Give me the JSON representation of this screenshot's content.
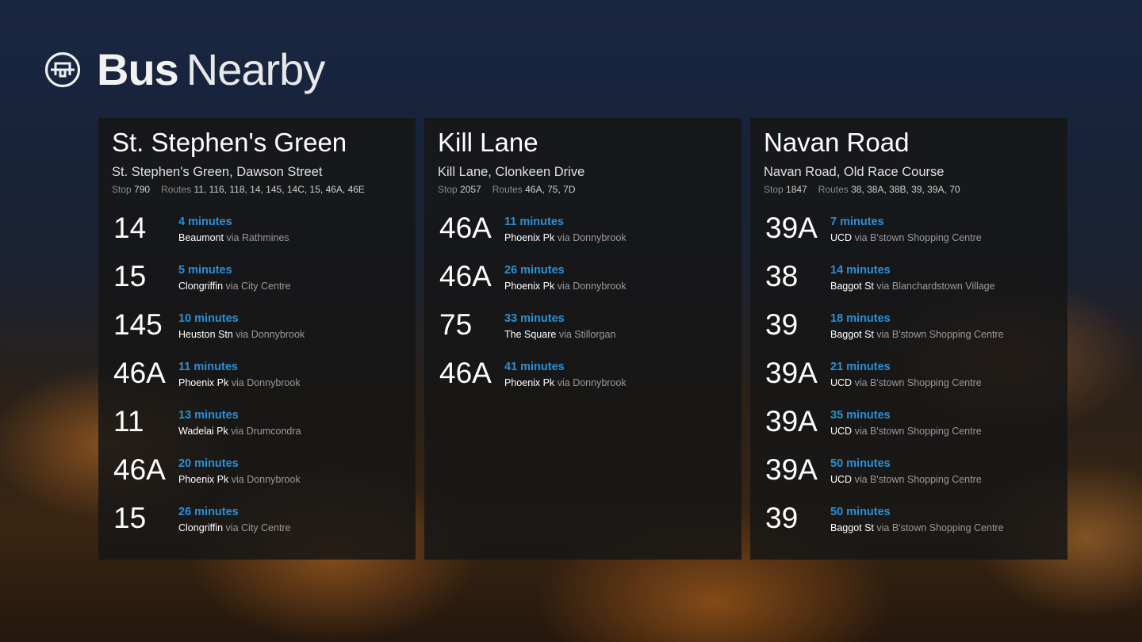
{
  "app": {
    "title_bold": "Bus",
    "title_light": "Nearby",
    "logo_icon": "bus-logo-icon"
  },
  "colors": {
    "accent": "#2b8fd6",
    "panel": "#161616"
  },
  "stops": [
    {
      "name": "St. Stephen's Green",
      "address": "St. Stephen's Green, Dawson Street",
      "stop_label": "Stop",
      "stop_number": "790",
      "routes_label": "Routes",
      "routes": "11, 116, 118, 14, 145, 14C, 15, 46A, 46E",
      "departures": [
        {
          "route": "14",
          "eta": "4 minutes",
          "destination": "Beaumont",
          "via_word": "via",
          "via": "Rathmines"
        },
        {
          "route": "15",
          "eta": "5 minutes",
          "destination": "Clongriffin",
          "via_word": "via",
          "via": "City Centre"
        },
        {
          "route": "145",
          "eta": "10 minutes",
          "destination": "Heuston Stn",
          "via_word": "via",
          "via": "Donnybrook"
        },
        {
          "route": "46A",
          "eta": "11 minutes",
          "destination": "Phoenix Pk",
          "via_word": "via",
          "via": "Donnybrook"
        },
        {
          "route": "11",
          "eta": "13 minutes",
          "destination": "Wadelai Pk",
          "via_word": "via",
          "via": "Drumcondra"
        },
        {
          "route": "46A",
          "eta": "20 minutes",
          "destination": "Phoenix Pk",
          "via_word": "via",
          "via": "Donnybrook"
        },
        {
          "route": "15",
          "eta": "26 minutes",
          "destination": "Clongriffin",
          "via_word": "via",
          "via": "City Centre"
        }
      ]
    },
    {
      "name": "Kill Lane",
      "address": "Kill Lane, Clonkeen Drive",
      "stop_label": "Stop",
      "stop_number": "2057",
      "routes_label": "Routes",
      "routes": "46A, 75, 7D",
      "departures": [
        {
          "route": "46A",
          "eta": "11 minutes",
          "destination": "Phoenix Pk",
          "via_word": "via",
          "via": "Donnybrook"
        },
        {
          "route": "46A",
          "eta": "26 minutes",
          "destination": "Phoenix Pk",
          "via_word": "via",
          "via": "Donnybrook"
        },
        {
          "route": "75",
          "eta": "33 minutes",
          "destination": "The Square",
          "via_word": "via",
          "via": "Stillorgan"
        },
        {
          "route": "46A",
          "eta": "41 minutes",
          "destination": "Phoenix Pk",
          "via_word": "via",
          "via": "Donnybrook"
        }
      ]
    },
    {
      "name": "Navan Road",
      "address": "Navan Road, Old Race Course",
      "stop_label": "Stop",
      "stop_number": "1847",
      "routes_label": "Routes",
      "routes": "38, 38A, 38B, 39, 39A, 70",
      "departures": [
        {
          "route": "39A",
          "eta": "7 minutes",
          "destination": "UCD",
          "via_word": "via",
          "via": "B'stown Shopping Centre"
        },
        {
          "route": "38",
          "eta": "14 minutes",
          "destination": "Baggot St",
          "via_word": "via",
          "via": "Blanchardstown Village"
        },
        {
          "route": "39",
          "eta": "18 minutes",
          "destination": "Baggot St",
          "via_word": "via",
          "via": "B'stown Shopping Centre"
        },
        {
          "route": "39A",
          "eta": "21 minutes",
          "destination": "UCD",
          "via_word": "via",
          "via": "B'stown Shopping Centre"
        },
        {
          "route": "39A",
          "eta": "35 minutes",
          "destination": "UCD",
          "via_word": "via",
          "via": "B'stown Shopping Centre"
        },
        {
          "route": "39A",
          "eta": "50 minutes",
          "destination": "UCD",
          "via_word": "via",
          "via": "B'stown Shopping Centre"
        },
        {
          "route": "39",
          "eta": "50 minutes",
          "destination": "Baggot St",
          "via_word": "via",
          "via": "B'stown Shopping Centre"
        }
      ]
    }
  ]
}
